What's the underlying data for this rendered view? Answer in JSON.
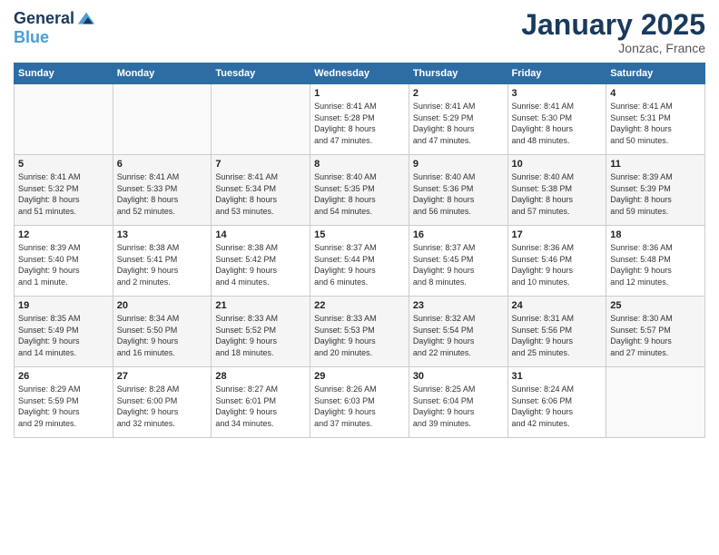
{
  "logo": {
    "line1": "General",
    "line2": "Blue"
  },
  "title": "January 2025",
  "location": "Jonzac, France",
  "days_header": [
    "Sunday",
    "Monday",
    "Tuesday",
    "Wednesday",
    "Thursday",
    "Friday",
    "Saturday"
  ],
  "weeks": [
    [
      {
        "day": "",
        "content": ""
      },
      {
        "day": "",
        "content": ""
      },
      {
        "day": "",
        "content": ""
      },
      {
        "day": "1",
        "content": "Sunrise: 8:41 AM\nSunset: 5:28 PM\nDaylight: 8 hours\nand 47 minutes."
      },
      {
        "day": "2",
        "content": "Sunrise: 8:41 AM\nSunset: 5:29 PM\nDaylight: 8 hours\nand 47 minutes."
      },
      {
        "day": "3",
        "content": "Sunrise: 8:41 AM\nSunset: 5:30 PM\nDaylight: 8 hours\nand 48 minutes."
      },
      {
        "day": "4",
        "content": "Sunrise: 8:41 AM\nSunset: 5:31 PM\nDaylight: 8 hours\nand 50 minutes."
      }
    ],
    [
      {
        "day": "5",
        "content": "Sunrise: 8:41 AM\nSunset: 5:32 PM\nDaylight: 8 hours\nand 51 minutes."
      },
      {
        "day": "6",
        "content": "Sunrise: 8:41 AM\nSunset: 5:33 PM\nDaylight: 8 hours\nand 52 minutes."
      },
      {
        "day": "7",
        "content": "Sunrise: 8:41 AM\nSunset: 5:34 PM\nDaylight: 8 hours\nand 53 minutes."
      },
      {
        "day": "8",
        "content": "Sunrise: 8:40 AM\nSunset: 5:35 PM\nDaylight: 8 hours\nand 54 minutes."
      },
      {
        "day": "9",
        "content": "Sunrise: 8:40 AM\nSunset: 5:36 PM\nDaylight: 8 hours\nand 56 minutes."
      },
      {
        "day": "10",
        "content": "Sunrise: 8:40 AM\nSunset: 5:38 PM\nDaylight: 8 hours\nand 57 minutes."
      },
      {
        "day": "11",
        "content": "Sunrise: 8:39 AM\nSunset: 5:39 PM\nDaylight: 8 hours\nand 59 minutes."
      }
    ],
    [
      {
        "day": "12",
        "content": "Sunrise: 8:39 AM\nSunset: 5:40 PM\nDaylight: 9 hours\nand 1 minute."
      },
      {
        "day": "13",
        "content": "Sunrise: 8:38 AM\nSunset: 5:41 PM\nDaylight: 9 hours\nand 2 minutes."
      },
      {
        "day": "14",
        "content": "Sunrise: 8:38 AM\nSunset: 5:42 PM\nDaylight: 9 hours\nand 4 minutes."
      },
      {
        "day": "15",
        "content": "Sunrise: 8:37 AM\nSunset: 5:44 PM\nDaylight: 9 hours\nand 6 minutes."
      },
      {
        "day": "16",
        "content": "Sunrise: 8:37 AM\nSunset: 5:45 PM\nDaylight: 9 hours\nand 8 minutes."
      },
      {
        "day": "17",
        "content": "Sunrise: 8:36 AM\nSunset: 5:46 PM\nDaylight: 9 hours\nand 10 minutes."
      },
      {
        "day": "18",
        "content": "Sunrise: 8:36 AM\nSunset: 5:48 PM\nDaylight: 9 hours\nand 12 minutes."
      }
    ],
    [
      {
        "day": "19",
        "content": "Sunrise: 8:35 AM\nSunset: 5:49 PM\nDaylight: 9 hours\nand 14 minutes."
      },
      {
        "day": "20",
        "content": "Sunrise: 8:34 AM\nSunset: 5:50 PM\nDaylight: 9 hours\nand 16 minutes."
      },
      {
        "day": "21",
        "content": "Sunrise: 8:33 AM\nSunset: 5:52 PM\nDaylight: 9 hours\nand 18 minutes."
      },
      {
        "day": "22",
        "content": "Sunrise: 8:33 AM\nSunset: 5:53 PM\nDaylight: 9 hours\nand 20 minutes."
      },
      {
        "day": "23",
        "content": "Sunrise: 8:32 AM\nSunset: 5:54 PM\nDaylight: 9 hours\nand 22 minutes."
      },
      {
        "day": "24",
        "content": "Sunrise: 8:31 AM\nSunset: 5:56 PM\nDaylight: 9 hours\nand 25 minutes."
      },
      {
        "day": "25",
        "content": "Sunrise: 8:30 AM\nSunset: 5:57 PM\nDaylight: 9 hours\nand 27 minutes."
      }
    ],
    [
      {
        "day": "26",
        "content": "Sunrise: 8:29 AM\nSunset: 5:59 PM\nDaylight: 9 hours\nand 29 minutes."
      },
      {
        "day": "27",
        "content": "Sunrise: 8:28 AM\nSunset: 6:00 PM\nDaylight: 9 hours\nand 32 minutes."
      },
      {
        "day": "28",
        "content": "Sunrise: 8:27 AM\nSunset: 6:01 PM\nDaylight: 9 hours\nand 34 minutes."
      },
      {
        "day": "29",
        "content": "Sunrise: 8:26 AM\nSunset: 6:03 PM\nDaylight: 9 hours\nand 37 minutes."
      },
      {
        "day": "30",
        "content": "Sunrise: 8:25 AM\nSunset: 6:04 PM\nDaylight: 9 hours\nand 39 minutes."
      },
      {
        "day": "31",
        "content": "Sunrise: 8:24 AM\nSunset: 6:06 PM\nDaylight: 9 hours\nand 42 minutes."
      },
      {
        "day": "",
        "content": ""
      }
    ]
  ]
}
